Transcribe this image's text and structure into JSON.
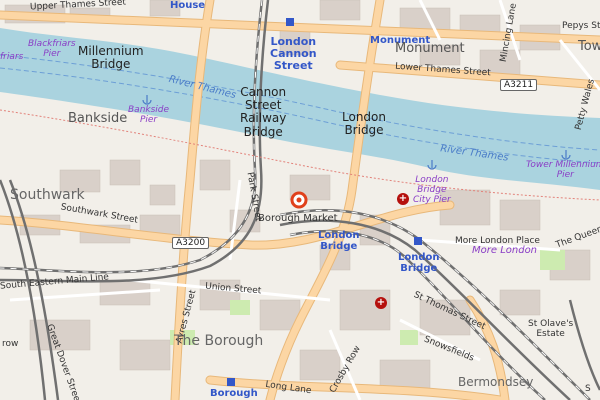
{
  "map": {
    "place_labels": {
      "southwark": "Southwark",
      "the_borough": "The Borough",
      "bermondsey": "Bermondsey",
      "bankside": "Bankside",
      "monument_area": "Monument",
      "borough_market": "Borough Market",
      "st_olaves_estate": "St Olave's\nEstate",
      "more_london": "More London",
      "tower": "Tow"
    },
    "bridges": {
      "millennium": "Millennium\nBridge",
      "cannon_street_railway": "Cannon\nStreet\nRailway\nBridge",
      "london_bridge": "London\nBridge"
    },
    "stations": {
      "cannon_street": "London\nCannon\nStreet",
      "monument": "Monument",
      "london_bridge_top": "London\nBridge",
      "london_bridge_main": "London\nBridge",
      "borough": "Borough",
      "house": "House"
    },
    "streets": {
      "upper_thames": "Upper Thames Street",
      "lower_thames": "Lower Thames Street",
      "southwark_street": "Southwark Street",
      "park_street": "Park Street",
      "union_street": "Union Street",
      "ayres_street": "Ayres Street",
      "crosby_row": "Crosby Row",
      "long_lane": "Long Lane",
      "st_thomas": "St Thomas Street",
      "snowsfields": "Snowsfields",
      "more_london_place": "More London Place",
      "south_eastern_main_line": "South Eastern Main Line",
      "mincing_lane": "Mincing Lane",
      "pepys_street": "Pepys Stree",
      "petty_wales": "Petty Wales",
      "the_queens": "The Queen's",
      "great_dover": "Great Dover Street",
      "redcross_row": "row",
      "dock": "S"
    },
    "road_refs": {
      "a3200": "A3200",
      "a3211": "A3211"
    },
    "piers": {
      "blackfriars": "Blackfriars\nPier",
      "bankside": "Bankside\nPier",
      "london_bridge_city": "London\nBridge\nCity Pier",
      "tower_millennium": "Tower Millennium\nPier",
      "friars": "friars"
    },
    "water": {
      "river_thames_west": "River Thames",
      "river_thames_east": "River Thames"
    },
    "colors": {
      "river": "#aad3df",
      "land": "#f2efe9",
      "buildings": "#d9d0c9",
      "primary_road": "#fcd6a4",
      "railway": "#707070",
      "park": "#cdebb0",
      "marker": "#e0401b",
      "hospital": "#b5100d"
    },
    "marker_icon": "location-marker-icon",
    "hospital_icon": "hospital-icon"
  }
}
